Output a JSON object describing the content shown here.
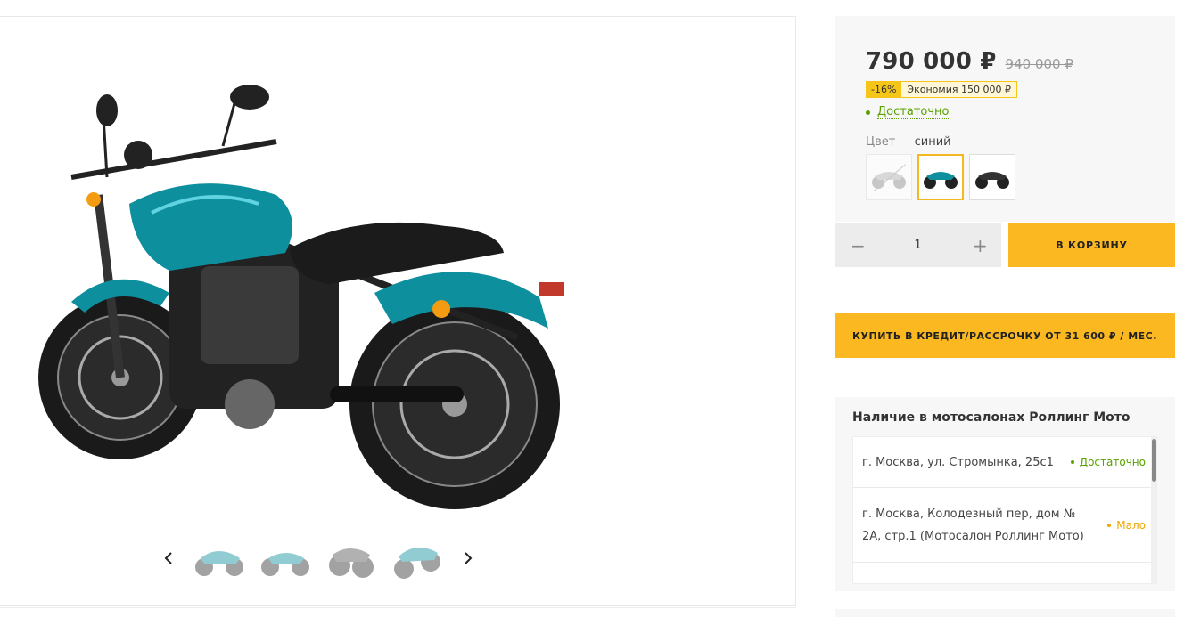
{
  "product": {
    "price": "790 000 ₽",
    "old_price": "940 000 ₽",
    "discount_badge": "-16%",
    "savings_badge": "Экономия 150 000 ₽",
    "stock_status": "Достаточно",
    "color_label": "Цвет",
    "color_dash": "—",
    "color_value": "синий",
    "colors": [
      "gray",
      "teal",
      "black"
    ],
    "quantity": "1",
    "add_to_cart": "В КОРЗИНУ",
    "credit_button": "КУПИТЬ В КРЕДИТ/РАССРОЧКУ ОТ 31 600 ₽ / МЕС."
  },
  "gallery": {
    "prev_icon": "chevron-left-icon",
    "next_icon": "chevron-right-icon",
    "thumbnail_count": 4
  },
  "availability": {
    "title": "Наличие в мотосалонах Роллинг Мото",
    "stores": [
      {
        "address": "г. Москва, ул. Стромынка, 25с1",
        "status": "Достаточно",
        "level": "ok"
      },
      {
        "address": "г. Москва, Колодезный пер, дом № 2А, стр.1 (Мотосалон Роллинг Мото)",
        "status": "Мало",
        "level": "low"
      }
    ]
  },
  "colors": {
    "accent": "#fbb820",
    "ok": "#5aa100",
    "low": "#f0a500",
    "bike_teal": "#0e8f9e"
  }
}
